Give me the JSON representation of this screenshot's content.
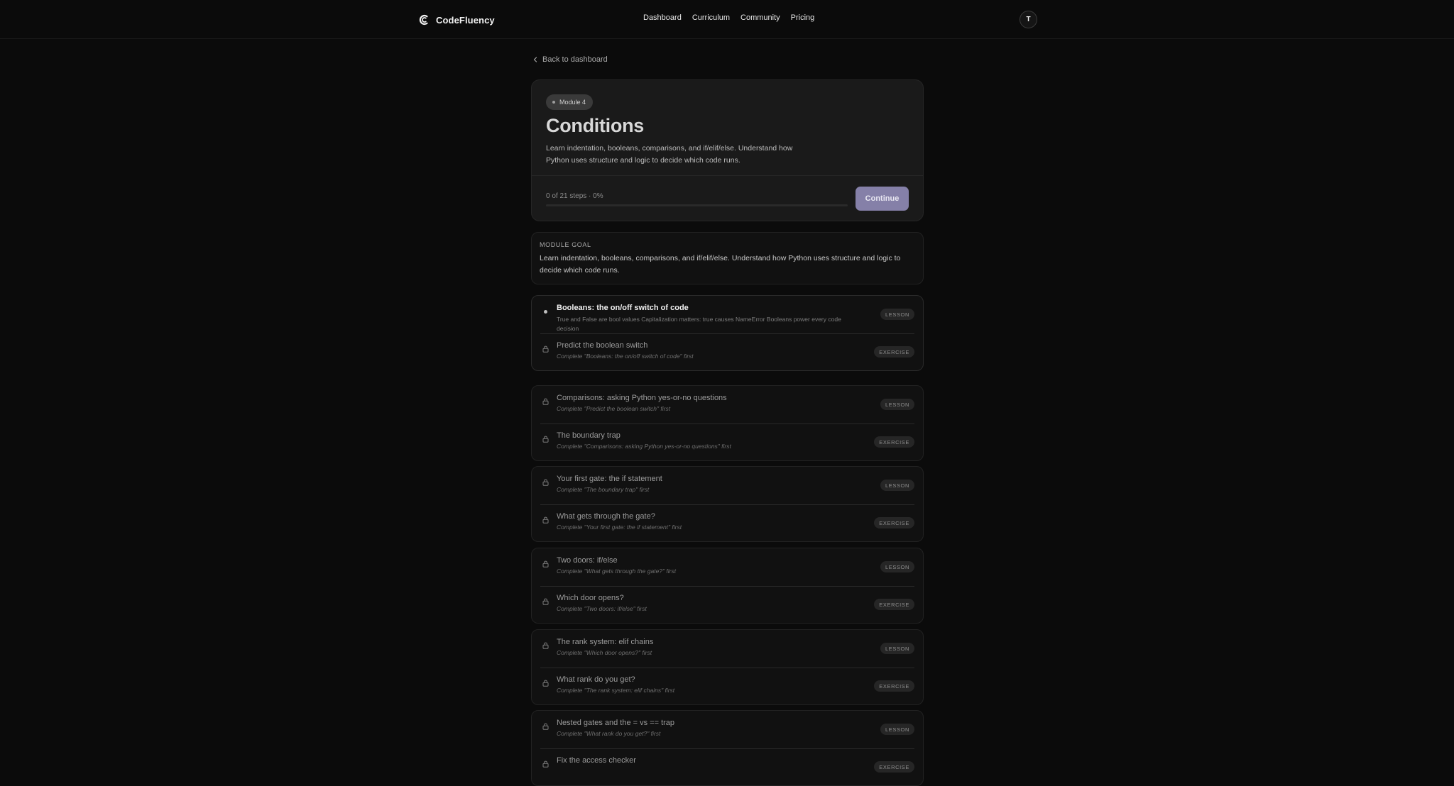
{
  "header": {
    "brand": "CodeFluency",
    "nav": [
      "Dashboard",
      "Curriculum",
      "Community",
      "Pricing"
    ],
    "avatar_initial": "T"
  },
  "back_link": "Back to dashboard",
  "module": {
    "badge": "Module 4",
    "title": "Conditions",
    "description": "Learn indentation, booleans, comparisons, and if/elif/else. Understand how Python uses structure and logic to decide which code runs.",
    "progress_text": "0 of 21 steps · 0%",
    "progress_fraction": 0,
    "continue_label": "Continue"
  },
  "goal": {
    "label": "MODULE GOAL",
    "text": "Learn indentation, booleans, comparisons, and if/elif/else. Understand how Python uses structure and logic to decide which code runs."
  },
  "steps": [
    {
      "title": "Booleans: the on/off switch of code",
      "subtitle": "True and False are bool values Capitalization matters: true causes NameError Booleans power every code decision",
      "type": "LESSON",
      "state": "current"
    },
    {
      "title": "Predict the boolean switch",
      "subtitle": "Complete \"Booleans: the on/off switch of code\" first",
      "type": "EXERCISE",
      "state": "locked"
    },
    {
      "title": "Comparisons: asking Python yes-or-no questions",
      "subtitle": "Complete \"Predict the boolean switch\" first",
      "type": "LESSON",
      "state": "locked"
    },
    {
      "title": "The boundary trap",
      "subtitle": "Complete \"Comparisons: asking Python yes-or-no questions\" first",
      "type": "EXERCISE",
      "state": "locked"
    },
    {
      "title": "Your first gate: the if statement",
      "subtitle": "Complete \"The boundary trap\" first",
      "type": "LESSON",
      "state": "locked"
    },
    {
      "title": "What gets through the gate?",
      "subtitle": "Complete \"Your first gate: the if statement\" first",
      "type": "EXERCISE",
      "state": "locked"
    },
    {
      "title": "Two doors: if/else",
      "subtitle": "Complete \"What gets through the gate?\" first",
      "type": "LESSON",
      "state": "locked"
    },
    {
      "title": "Which door opens?",
      "subtitle": "Complete \"Two doors: if/else\" first",
      "type": "EXERCISE",
      "state": "locked"
    },
    {
      "title": "The rank system: elif chains",
      "subtitle": "Complete \"Which door opens?\" first",
      "type": "LESSON",
      "state": "locked"
    },
    {
      "title": "What rank do you get?",
      "subtitle": "Complete \"The rank system: elif chains\" first",
      "type": "EXERCISE",
      "state": "locked"
    },
    {
      "title": "Nested gates and the = vs == trap",
      "subtitle": "Complete \"What rank do you get?\" first",
      "type": "LESSON",
      "state": "locked"
    },
    {
      "title": "Fix the access checker",
      "subtitle": "",
      "type": "EXERCISE",
      "state": "locked"
    }
  ]
}
